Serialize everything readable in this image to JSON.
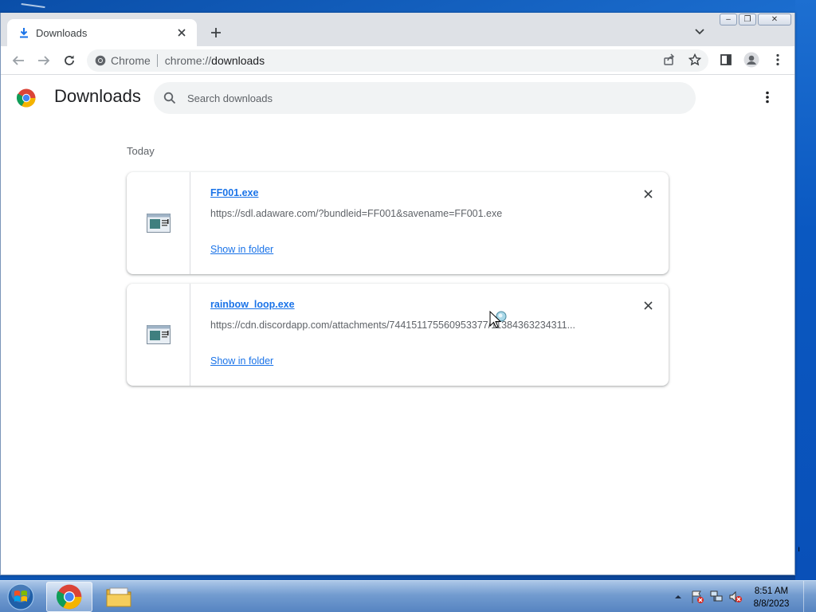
{
  "window": {
    "tab": {
      "title": "Downloads",
      "icon": "download-icon"
    },
    "controls": {
      "minimize": "minimize-icon",
      "restore": "restore-icon",
      "close": "close-icon"
    }
  },
  "toolbar": {
    "site_chip": "Chrome",
    "url": "chrome://downloads",
    "url_scheme": "chrome://",
    "url_host": "downloads"
  },
  "page": {
    "title": "Downloads",
    "search_placeholder": "Search downloads",
    "date_group": "Today"
  },
  "downloads": [
    {
      "filename": "FF001.exe",
      "url": "https://sdl.adaware.com/?bundleid=FF001&savename=FF001.exe",
      "action": "Show in folder"
    },
    {
      "filename": "rainbow_loop.exe",
      "url": "https://cdn.discordapp.com/attachments/744151175560953377/11384363234311...",
      "action": "Show in folder"
    }
  ],
  "taskbar": {
    "time": "8:51 AM",
    "date": "8/8/2023"
  },
  "colors": {
    "accent": "#1a73e8",
    "tabstrip": "#dee1e6",
    "omnibox": "#f1f3f4"
  }
}
